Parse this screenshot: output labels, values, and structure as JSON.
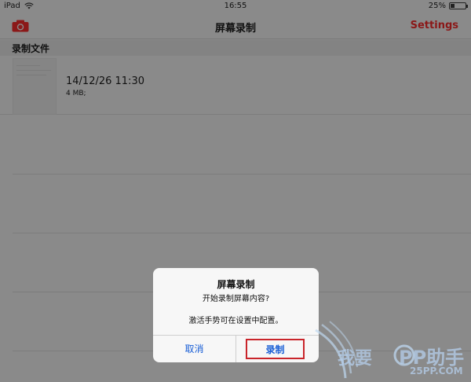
{
  "status_bar": {
    "device": "iPad",
    "time": "16:55",
    "battery_percent": "25%",
    "battery_level": 0.25
  },
  "nav": {
    "title": "屏幕录制",
    "settings_label": "Settings",
    "camera_icon": "camera-icon",
    "accent_color": "#8b1818"
  },
  "section": {
    "header": "录制文件"
  },
  "files": [
    {
      "date": "14/12/26 11:30",
      "size": "4 MB;"
    }
  ],
  "alert": {
    "title": "屏幕录制",
    "message": "开始录制屏幕内容?",
    "note": "激活手势可在设置中配置。",
    "cancel_label": "取消",
    "record_label": "录制",
    "button_color": "#1a5fd6",
    "highlight_color": "#c9242a"
  },
  "watermark": {
    "line1": "我要",
    "brand": "PP助手",
    "site": "25PP.COM"
  }
}
